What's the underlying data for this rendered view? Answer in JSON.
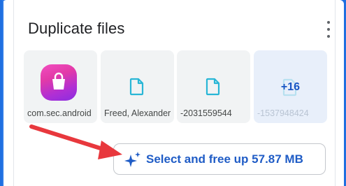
{
  "card": {
    "title": "Duplicate files",
    "menu_icon": "more-vert-icon"
  },
  "files": [
    {
      "label": "com.sec.android",
      "icon": "galaxy-store-app-icon"
    },
    {
      "label": "Freed, Alexander",
      "icon": "document-icon"
    },
    {
      "label": "-2031559544",
      "icon": "document-icon"
    },
    {
      "label": "-1537948424",
      "icon": "document-icon",
      "overlay": "+16"
    }
  ],
  "action": {
    "label": "Select and free up 57.87 MB",
    "icon": "sparkle-icon"
  },
  "annotation": {
    "icon": "red-arrow-icon",
    "color": "#e8383d"
  },
  "colors": {
    "accent": "#1f5cc6",
    "doc_icon": "#29b6d6",
    "background": "#1f6fe0"
  }
}
